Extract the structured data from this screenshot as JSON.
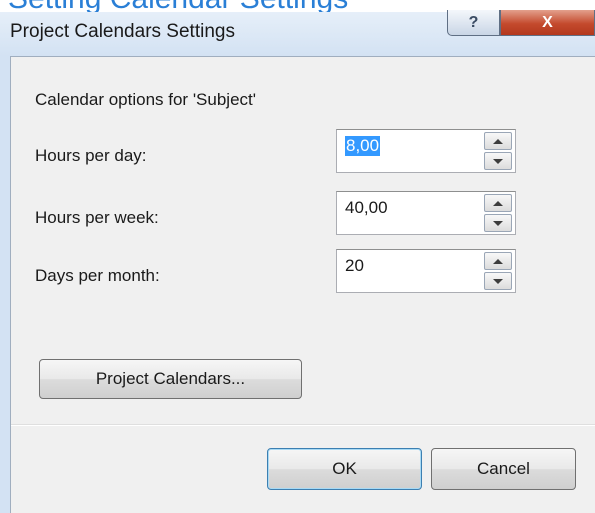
{
  "background_heading": "Setting Calendar Settings",
  "dialog": {
    "title": "Project Calendars Settings",
    "help_glyph": "?",
    "close_glyph": "X",
    "options_caption": "Calendar options for 'Subject'",
    "fields": [
      {
        "label": "Hours per day:",
        "value": "8,00",
        "selected": true
      },
      {
        "label": "Hours per week:",
        "value": "40,00",
        "selected": false
      },
      {
        "label": "Days per month:",
        "value": "20",
        "selected": false
      }
    ],
    "project_calendars_button": "Project Calendars...",
    "ok_button": "OK",
    "cancel_button": "Cancel"
  },
  "colors": {
    "accent": "#2a7fd6",
    "selection": "#3399ff",
    "close_button": "#c44a2d"
  }
}
